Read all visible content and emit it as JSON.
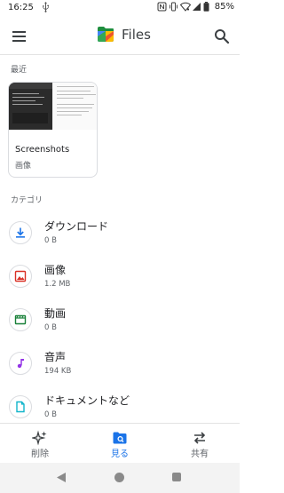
{
  "status_bar": {
    "time": "16:25",
    "battery": "85%"
  },
  "app_bar": {
    "title": "Files"
  },
  "recent": {
    "section_label": "最近",
    "card": {
      "name": "Screenshots",
      "subtitle": "画像"
    }
  },
  "categories": {
    "section_label": "カテゴリ",
    "items": [
      {
        "name": "ダウンロード",
        "size": "0 B",
        "icon": "download-icon",
        "color": "#1a73e8"
      },
      {
        "name": "画像",
        "size": "1.2 MB",
        "icon": "image-icon",
        "color": "#d93025"
      },
      {
        "name": "動画",
        "size": "0 B",
        "icon": "video-icon",
        "color": "#188038"
      },
      {
        "name": "音声",
        "size": "194 KB",
        "icon": "audio-icon",
        "color": "#9334e6"
      },
      {
        "name": "ドキュメントなど",
        "size": "0 B",
        "icon": "document-icon",
        "color": "#12b5cb"
      }
    ]
  },
  "bottom_nav": {
    "items": [
      {
        "label": "削除",
        "icon": "sparkle-icon",
        "active": false
      },
      {
        "label": "見る",
        "icon": "browse-icon",
        "active": true
      },
      {
        "label": "共有",
        "icon": "share-icon",
        "active": false
      }
    ]
  },
  "colors": {
    "accent": "#1a73e8",
    "divider": "#e3e3e3",
    "text_secondary": "#5f6368"
  }
}
